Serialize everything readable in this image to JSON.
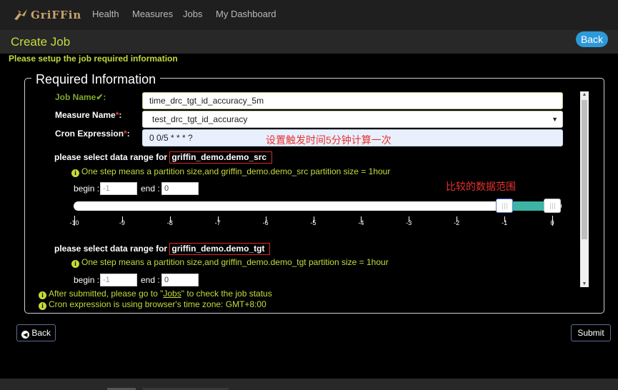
{
  "app": {
    "name": "GriFFin"
  },
  "nav": [
    "Health",
    "Measures",
    "Jobs",
    "My Dashboard"
  ],
  "page": {
    "title": "Create Job",
    "back_label": "Back",
    "subtitle": "Please setup the job required information"
  },
  "form": {
    "legend": "Required Information",
    "job_name": {
      "label": "Job Name",
      "value": "time_drc_tgt_id_accuracy_5m"
    },
    "measure_name": {
      "label": "Measure Name",
      "star": "*",
      "colon": ":",
      "value": "test_drc_tgt_id_accuracy"
    },
    "cron": {
      "label": "Cron Expression",
      "star": "*",
      "colon": ":",
      "value": "0 0/5 * * * ?"
    },
    "src": {
      "title_prefix": "please select data range for ",
      "source": "griffin_demo.demo_src",
      "hint": "One step means a partition size,and griffin_demo.demo_src partition size = 1hour",
      "begin_label": "begin :",
      "begin": "-1",
      "end_label": "end :",
      "end": "0",
      "slider": {
        "min": -10,
        "max": 0,
        "begin": -1,
        "end": 0,
        "ticks": [
          "-10",
          "-9",
          "-8",
          "-7",
          "-6",
          "-5",
          "-4",
          "-3",
          "-2",
          "-1",
          "0"
        ]
      }
    },
    "tgt": {
      "title_prefix": "please select data range for ",
      "source": "griffin_demo.demo_tgt",
      "hint": "One step means a partition size,and griffin_demo.demo_tgt partition size = 1hour",
      "begin_label": "begin :",
      "begin": "-1",
      "end_label": "end :",
      "end": "0"
    },
    "notes": [
      {
        "pre": "After submitted, please go to \"",
        "link": "Jobs",
        "post": "\" to check the job status"
      },
      {
        "text": "Cron expression is using browser's time zone: GMT+8:00"
      }
    ]
  },
  "annotations": {
    "cron_note": "设置触发时间5分钟计算一次",
    "range_note": "比较的数据范围"
  },
  "buttons": {
    "back": "Back",
    "submit": "Submit"
  },
  "icons": {
    "info": "info-circle-icon",
    "check": "check-icon",
    "back": "arrow-circle-left-icon",
    "dropdown": "caret-down-icon"
  },
  "colors": {
    "accent": "#c6da3c",
    "primary": "#2d99d9",
    "range": "#3cb5a4",
    "annotation": "#e8322e"
  }
}
